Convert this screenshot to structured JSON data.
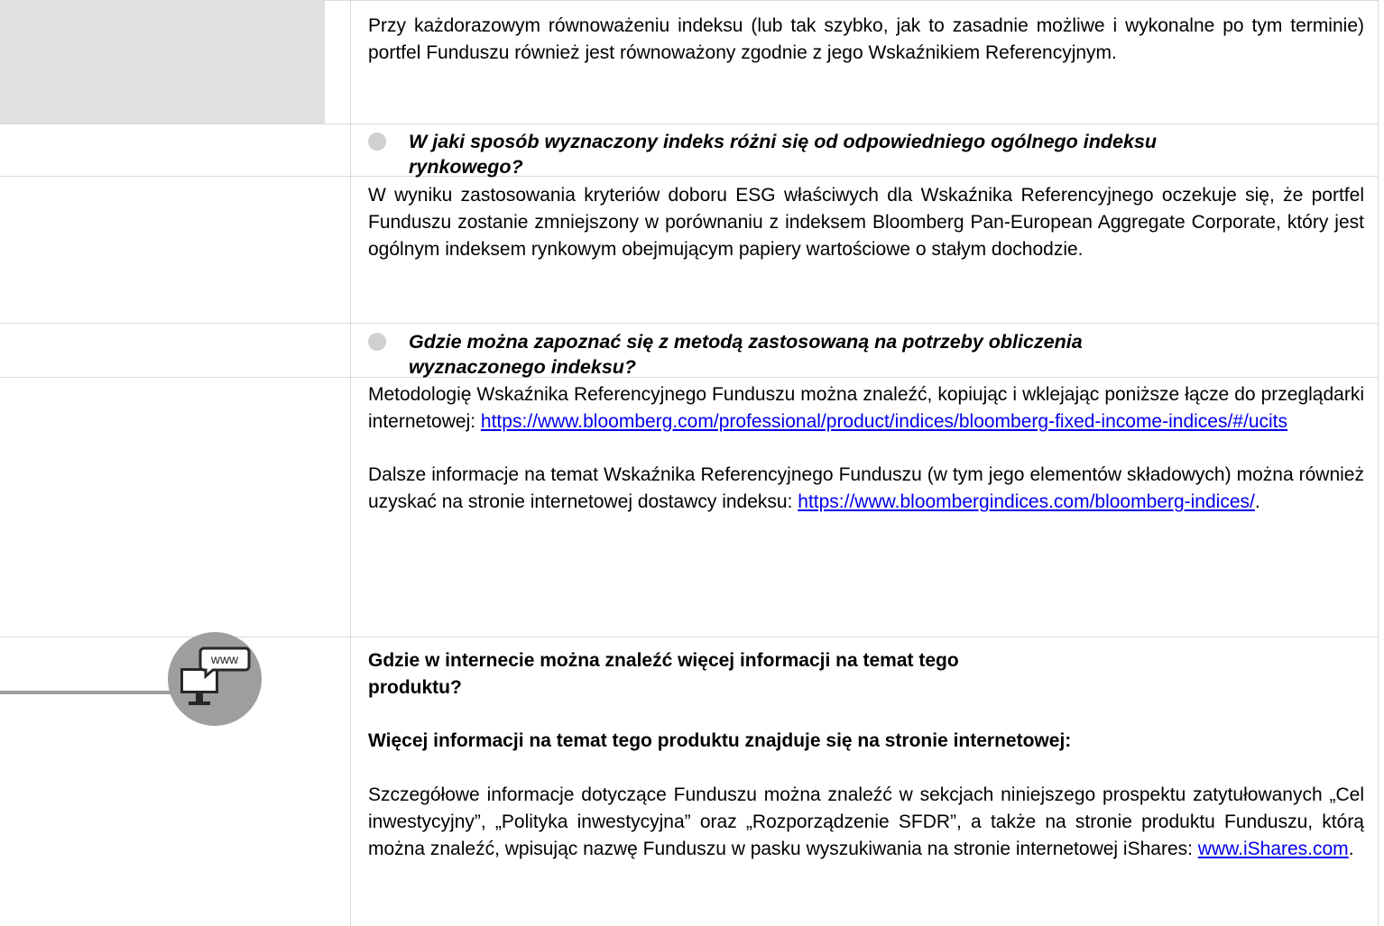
{
  "row1": {
    "text": "Przy każdorazowym równoważeniu indeksu (lub tak szybko, jak to zasadnie możliwe i wykonalne po tym terminie) portfel Funduszu również jest równoważony zgodnie z jego Wskaźnikiem Referencyjnym."
  },
  "row2": {
    "question_line1": "W jaki sposób wyznaczony indeks różni się od odpowiedniego ogólnego indeksu",
    "question_line2": "rynkowego?"
  },
  "row3": {
    "text": "W wyniku zastosowania kryteriów doboru ESG właściwych dla Wskaźnika Referencyjnego oczekuje się, że portfel Funduszu zostanie zmniejszony w porównaniu z indeksem Bloomberg Pan-European Aggregate Corporate, który jest ogólnym indeksem rynkowym obejmującym papiery wartościowe o stałym dochodzie."
  },
  "row4": {
    "question_line1": "Gdzie można zapoznać się z metodą zastosowaną na potrzeby obliczenia",
    "question_line2": "wyznaczonego indeksu?"
  },
  "row5": {
    "para1_text": "Metodologię Wskaźnika Referencyjnego Funduszu można znaleźć, kopiując i wklejając poniższe łącze do przeglądarki internetowej:",
    "link1": "https://www.bloomberg.com/professional/product/indices/bloomberg-fixed-income-indices/#/ucits",
    "para2_text": "Dalsze informacje na temat Wskaźnika Referencyjnego Funduszu (w tym jego elementów składowych) można również uzyskać na stronie internetowej dostawcy indeksu:",
    "link2": "https://www.bloombergindices.com/bloomberg-indices/",
    "link2_suffix": "."
  },
  "row6": {
    "icon_label": "www",
    "heading_line1": "Gdzie w internecie można znaleźć więcej informacji na temat tego",
    "heading_line2": "produktu?",
    "subheading": "Więcej informacji na temat tego produktu znajduje się na stronie internetowej:",
    "body_text": "Szczegółowe informacje dotyczące Funduszu można znaleźć w sekcjach niniejszego prospektu zatytułowanych „Cel inwestycyjny”, „Polityka inwestycyjna” oraz „Rozporządzenie SFDR”, a także na stronie produktu Funduszu, którą można znaleźć, wpisując nazwę Funduszu w pasku wyszukiwania na stronie internetowej iShares:",
    "link": "www.iShares.com",
    "link_suffix": "."
  },
  "colors": {
    "link": "#0000ee",
    "gray_block": "#e0e0e0",
    "icon_gray": "#9e9e9e",
    "rule": "#d9d9d9"
  }
}
